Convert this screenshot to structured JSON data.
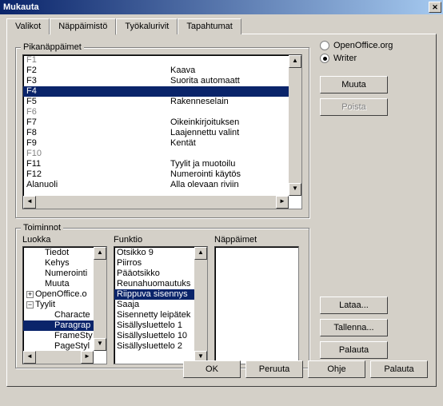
{
  "window": {
    "title": "Mukauta"
  },
  "tabs": {
    "items": [
      {
        "label": "Valikot"
      },
      {
        "label": "Näppäimistö"
      },
      {
        "label": "Työkalurivit"
      },
      {
        "label": "Tapahtumat"
      }
    ]
  },
  "radios": {
    "openoffice": "OpenOffice.org",
    "writer": "Writer",
    "selected": "writer"
  },
  "buttons": {
    "muuta": "Muuta",
    "poista": "Poista",
    "lataa": "Lataa...",
    "tallenna": "Tallenna...",
    "palauta": "Palauta",
    "ok": "OK",
    "peruuta": "Peruuta",
    "ohje": "Ohje",
    "palauta2": "Palauta"
  },
  "shortcut_group": {
    "label": "Pikanäppäimet",
    "rows": [
      {
        "key": "F1",
        "cmd": "",
        "state": "disabled"
      },
      {
        "key": "F2",
        "cmd": "Kaava",
        "state": ""
      },
      {
        "key": "F3",
        "cmd": "Suorita automaatt",
        "state": ""
      },
      {
        "key": "F4",
        "cmd": "",
        "state": "sel"
      },
      {
        "key": "F5",
        "cmd": "Rakenneselain",
        "state": ""
      },
      {
        "key": "F6",
        "cmd": "",
        "state": "disabled"
      },
      {
        "key": "F7",
        "cmd": "Oikeinkirjoituksen",
        "state": ""
      },
      {
        "key": "F8",
        "cmd": "Laajennettu valint",
        "state": ""
      },
      {
        "key": "F9",
        "cmd": "Kentät",
        "state": ""
      },
      {
        "key": "F10",
        "cmd": "",
        "state": "disabled"
      },
      {
        "key": "F11",
        "cmd": "Tyylit ja muotoilu",
        "state": ""
      },
      {
        "key": "F12",
        "cmd": "Numerointi käytös",
        "state": ""
      },
      {
        "key": "Alanuoli",
        "cmd": "Alla olevaan riviin",
        "state": ""
      }
    ]
  },
  "functions": {
    "label": "Toiminnot",
    "luokka": {
      "label": "Luokka",
      "items": [
        {
          "label": "Tiedot",
          "indent": 1
        },
        {
          "label": "Kehys",
          "indent": 1
        },
        {
          "label": "Numerointi",
          "indent": 1
        },
        {
          "label": "Muuta",
          "indent": 1
        },
        {
          "label": "OpenOffice.o",
          "indent": 0,
          "icon": "plus"
        },
        {
          "label": "Tyylit",
          "indent": 0,
          "icon": "minus"
        },
        {
          "label": "Characte",
          "indent": 2
        },
        {
          "label": "Paragrap",
          "indent": 2,
          "sel": true
        },
        {
          "label": "FrameSty",
          "indent": 2
        },
        {
          "label": "PageStyl",
          "indent": 2
        }
      ]
    },
    "funktio": {
      "label": "Funktio",
      "items": [
        {
          "label": "Otsikko 9"
        },
        {
          "label": "Piirros"
        },
        {
          "label": "Pääotsikko"
        },
        {
          "label": "Reunahuomautuks"
        },
        {
          "label": "Riippuva sisennys",
          "sel": true
        },
        {
          "label": "Saaja"
        },
        {
          "label": "Sisennetty leipätek"
        },
        {
          "label": "Sisällysluettelo 1"
        },
        {
          "label": "Sisällysluettelo 10"
        },
        {
          "label": "Sisällysluettelo 2"
        }
      ]
    },
    "nappaimet": {
      "label": "Näppäimet"
    }
  }
}
